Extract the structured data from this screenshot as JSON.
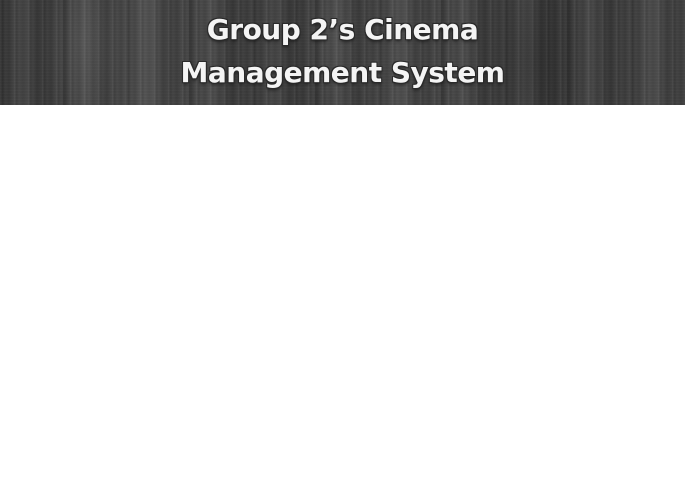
{
  "header": {
    "title_line1": "Group 2’s Cinema",
    "title_line2": "Management System"
  },
  "colors": {
    "header_background": "#3f3f3f",
    "title_text": "#f4f4f4",
    "page_background": "#ffffff"
  }
}
